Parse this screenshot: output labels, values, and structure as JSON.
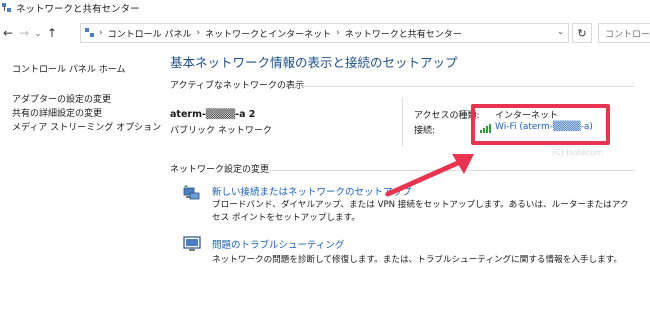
{
  "window": {
    "title": "ネットワークと共有センター",
    "icon": "network-center-icon"
  },
  "nav": {
    "back_icon": "←",
    "forward_icon": "→",
    "history_icon": "⌄",
    "up_icon": "↑",
    "breadcrumb": [
      "コントロール パネル",
      "ネットワークとインターネット",
      "ネットワークと共有センター"
    ],
    "breadcrumb_sep": "›",
    "dropdown_icon": "⌄",
    "refresh_icon": "↻",
    "search_placeholder": "コントロール"
  },
  "sidebar": {
    "home": "コントロール パネル ホーム",
    "items": [
      {
        "label": "アダプターの設定の変更"
      },
      {
        "label": "共有の詳細設定の変更"
      },
      {
        "label": "メディア ストリーミング オプション"
      }
    ]
  },
  "main": {
    "title": "基本ネットワーク情報の表示と接続のセットアップ",
    "active_networks_title": "アクティブなネットワークの表示",
    "network_name": "aterm-▒▒▒▒-a 2",
    "network_type": "パブリック ネットワーク",
    "access_type_label": "アクセスの種類:",
    "access_type_value": "インターネット",
    "connection_label": "接続:",
    "connection_value": "Wi-Fi (aterm-▒▒▒▒-a)",
    "change_settings_title": "ネットワーク設定の変更",
    "tasks": [
      {
        "link": "新しい接続またはネットワークのセットアップ",
        "desc": "ブロードバンド、ダイヤルアップ、または VPN 接続をセットアップします。あるいは、ルーターまたはアクセス ポイントをセットアップします。"
      },
      {
        "link": "問題のトラブルシューティング",
        "desc": "ネットワークの問題を診断して修復します。または、トラブルシューティングに関する情報を入手します。"
      }
    ]
  },
  "annotation": {
    "highlight_color": "#e8344e",
    "watermark": "(C) Isotecom"
  },
  "colors": {
    "link": "#1a5fb4",
    "title": "#1e4f8a",
    "signal": "#2e9b3a"
  }
}
